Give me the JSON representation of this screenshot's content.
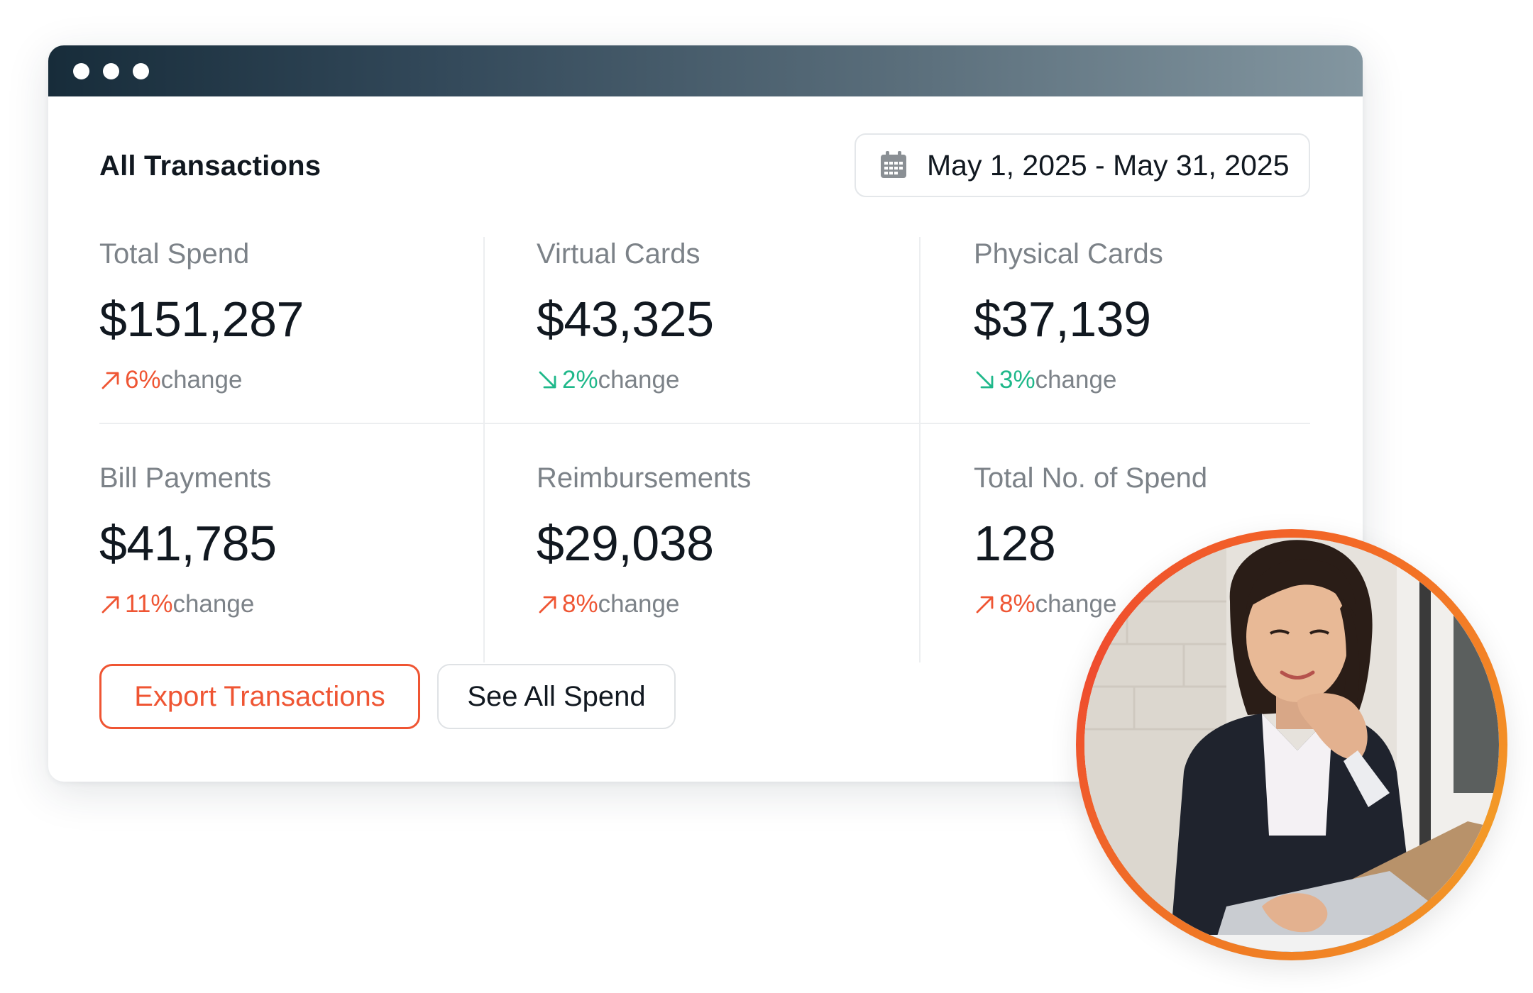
{
  "panel": {
    "title": "All Transactions",
    "date_range": "May 1, 2025 - May 31, 2025"
  },
  "stats": [
    {
      "label": "Total Spend",
      "value": "$151,287",
      "change_pct": "6%",
      "change_word": "change",
      "direction": "up"
    },
    {
      "label": "Virtual Cards",
      "value": "$43,325",
      "change_pct": "2%",
      "change_word": "change",
      "direction": "down"
    },
    {
      "label": "Physical Cards",
      "value": "$37,139",
      "change_pct": "3%",
      "change_word": "change",
      "direction": "down"
    },
    {
      "label": "Bill Payments",
      "value": "$41,785",
      "change_pct": "11%",
      "change_word": "change",
      "direction": "up"
    },
    {
      "label": "Reimbursements",
      "value": "$29,038",
      "change_pct": "8%",
      "change_word": "change",
      "direction": "up"
    },
    {
      "label": "Total No. of Spend",
      "value": "128",
      "change_pct": "8%",
      "change_word": "change",
      "direction": "up"
    }
  ],
  "buttons": {
    "export_label": "Export Transactions",
    "see_all_label": "See All Spend"
  },
  "icons": {
    "window_controls": "window-dot-icons",
    "calendar": "calendar-icon",
    "trend_up": "arrow-up-right-icon",
    "trend_down": "arrow-down-right-icon"
  },
  "colors": {
    "accent": "#ef5533",
    "positive": "#1fb88a",
    "muted_text": "#7c8288",
    "primary_text": "#111820",
    "titlebar_dark": "#172c3a",
    "titlebar_light": "#8396a0",
    "ring_orange": "#f07a24"
  }
}
